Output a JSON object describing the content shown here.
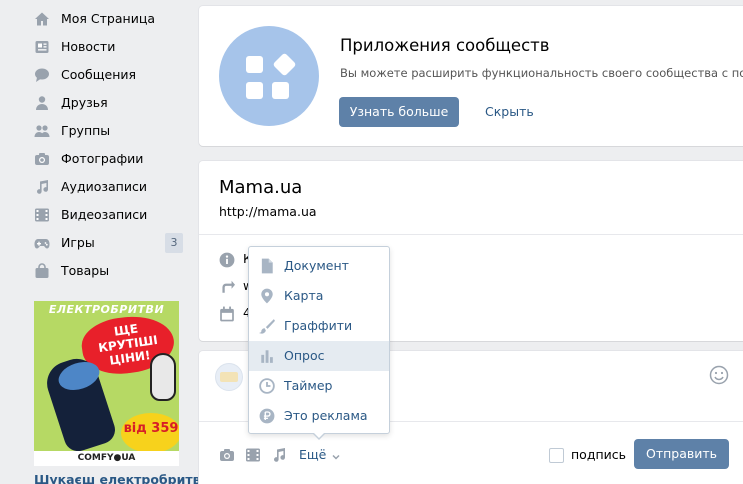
{
  "colors": {
    "link": "#2a5885",
    "button": "#5e81a8",
    "nav_icon": "#99a2ad",
    "menu_icon": "#a8b5c4",
    "promo_icon_bg": "#a6c4ea",
    "menu_active_bg": "#e5ebf1"
  },
  "sidebar": {
    "items": [
      {
        "label": "Моя Страница",
        "icon": "home-icon"
      },
      {
        "label": "Новости",
        "icon": "news-icon"
      },
      {
        "label": "Сообщения",
        "icon": "messages-icon"
      },
      {
        "label": "Друзья",
        "icon": "friends-icon"
      },
      {
        "label": "Группы",
        "icon": "groups-icon"
      },
      {
        "label": "Фотографии",
        "icon": "camera-icon"
      },
      {
        "label": "Аудиозаписи",
        "icon": "music-note-icon"
      },
      {
        "label": "Видеозаписи",
        "icon": "film-icon"
      },
      {
        "label": "Игры",
        "icon": "gamepad-icon",
        "count": "3"
      },
      {
        "label": "Товары",
        "icon": "shopping-bag-icon"
      }
    ],
    "ad": {
      "headline": "ЕЛЕКТРОБРИТВИ",
      "burst_line1": "ЩЕ",
      "burst_line2": "КРУТІШІ",
      "burst_line3": "ЦІНИ!",
      "price": "від 359",
      "brand": "COMFY●UA",
      "caption": "Шукаєш електробритву?"
    }
  },
  "promo": {
    "title": "Приложения сообществ",
    "description": "Вы можете расширить функциональность своего сообщества с по",
    "learn_more": "Узнать больше",
    "hide": "Скрыть"
  },
  "community": {
    "name": "Mama.ua",
    "url": "http://mama.ua",
    "rows": [
      {
        "icon": "info-icon",
        "text": "К"
      },
      {
        "icon": "share-arrow-icon",
        "text": "w"
      },
      {
        "icon": "calendar-icon",
        "text": "4"
      }
    ]
  },
  "composer": {
    "more": "Ещё",
    "signature": "подпись",
    "send": "Отправить"
  },
  "more_menu": {
    "items": [
      {
        "label": "Документ",
        "icon": "document-icon"
      },
      {
        "label": "Карта",
        "icon": "map-pin-icon"
      },
      {
        "label": "Граффити",
        "icon": "brush-icon"
      },
      {
        "label": "Опрос",
        "icon": "poll-icon",
        "active": true
      },
      {
        "label": "Таймер",
        "icon": "timer-icon"
      },
      {
        "label": "Это реклама",
        "icon": "ruble-icon"
      }
    ]
  }
}
